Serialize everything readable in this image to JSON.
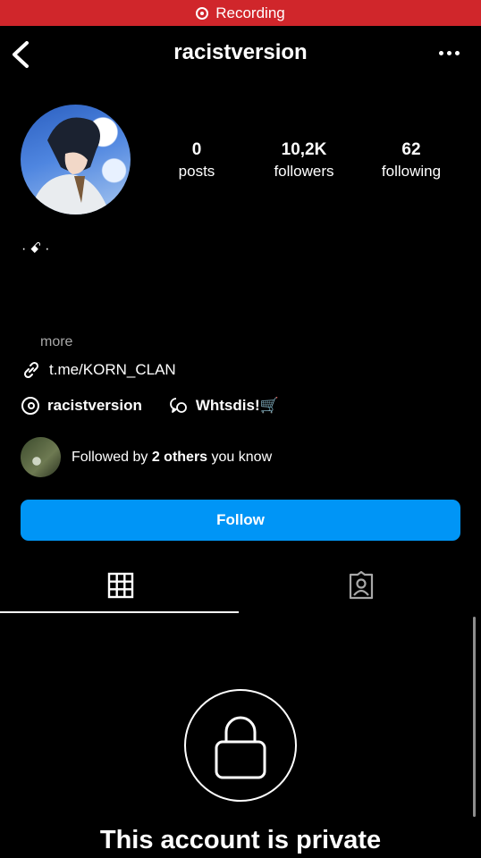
{
  "recording": {
    "label": "Recording",
    "color": "#d0262b"
  },
  "header": {
    "username": "racistversion"
  },
  "stats": [
    {
      "value": "0",
      "label": "posts"
    },
    {
      "value": "10,2K",
      "label": "followers"
    },
    {
      "value": "62",
      "label": "following"
    }
  ],
  "bio": {
    "symbols": "·ꗃ·",
    "more_label": "more"
  },
  "link": {
    "text": "t.me/KORN_CLAN"
  },
  "threads": {
    "handle": "racistversion",
    "chat_label": "Whtsdis!🛒"
  },
  "followed_by": {
    "prefix": "Followed by ",
    "bold": "2 others",
    "suffix": " you know"
  },
  "follow_button": {
    "label": "Follow",
    "color": "#0095f6"
  },
  "private": {
    "message": "This account is private"
  }
}
